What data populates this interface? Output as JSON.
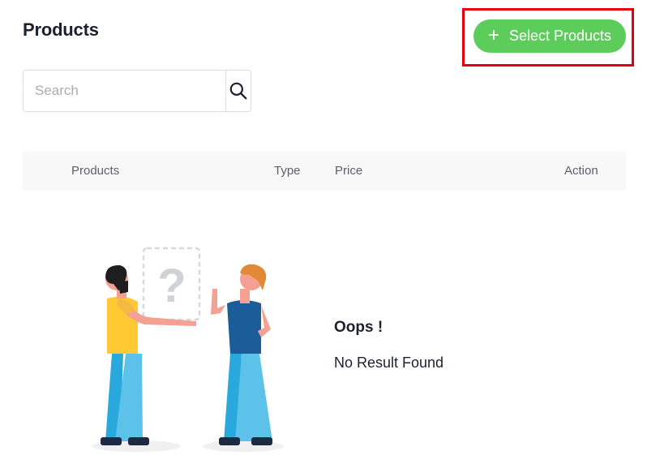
{
  "header": {
    "title": "Products",
    "select_button_label": "Select Products",
    "select_button_icon": "plus-icon"
  },
  "search": {
    "placeholder": "Search",
    "value": "",
    "icon": "search-icon"
  },
  "table": {
    "columns": [
      "Products",
      "Type",
      "Price",
      "Action"
    ],
    "rows": []
  },
  "empty_state": {
    "title": "Oops !",
    "message": "No Result Found",
    "illustration": "two-people-question-mark"
  },
  "colors": {
    "accent": "#5ccc5a",
    "highlight": "#e5000f",
    "header_bg": "#f8f8f8"
  }
}
